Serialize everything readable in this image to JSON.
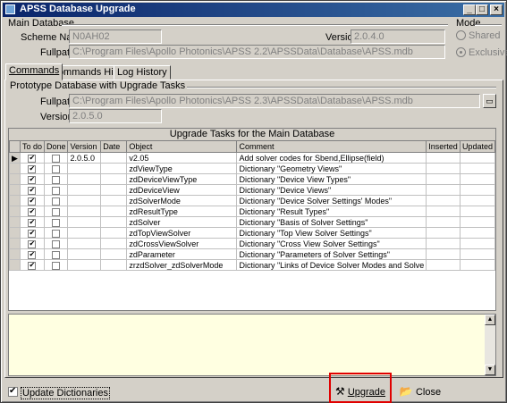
{
  "window": {
    "title": "APSS Database Upgrade"
  },
  "main_database": {
    "group_label": "Main Database",
    "scheme_label": "Scheme Name:",
    "scheme_value": "N0AH02",
    "version_label": "Version:",
    "version_value": "2.0.4.0",
    "fullpath_label": "Fullpath:",
    "fullpath_value": "C:\\Program Files\\Apollo Photonics\\APSS 2.2\\APSSData\\Database\\APSS.mdb"
  },
  "mode": {
    "label": "Mode",
    "options": [
      "Shared",
      "Exclusive"
    ],
    "selected": "Exclusive"
  },
  "tabs": [
    "Commands",
    "Commands History",
    "Log History"
  ],
  "active_tab": "Commands",
  "prototype": {
    "group_label": "Prototype Database with Upgrade Tasks",
    "fullpath_label": "Fullpath:",
    "fullpath_value": "C:\\Program Files\\Apollo Photonics\\APSS 2.3\\APSSData\\Database\\APSS.mdb",
    "version_label": "Version:",
    "version_value": "2.0.5.0"
  },
  "grid": {
    "caption": "Upgrade Tasks for the Main Database",
    "columns": [
      "To do",
      "Done",
      "Version",
      "Date",
      "Object",
      "Comment",
      "Inserted",
      "Updated"
    ],
    "rows": [
      {
        "todo": true,
        "done": false,
        "version": "2.0.5.0",
        "date": "",
        "object": "v2.05",
        "comment": "Add solver codes for Sbend,Ellipse(field)"
      },
      {
        "todo": true,
        "done": false,
        "version": "",
        "date": "",
        "object": "zdViewType",
        "comment": "Dictionary \"Geometry Views\""
      },
      {
        "todo": true,
        "done": false,
        "version": "",
        "date": "",
        "object": "zdDeviceViewType",
        "comment": "Dictionary \"Device View Types\""
      },
      {
        "todo": true,
        "done": false,
        "version": "",
        "date": "",
        "object": "zdDeviceView",
        "comment": "Dictionary \"Device Views\""
      },
      {
        "todo": true,
        "done": false,
        "version": "",
        "date": "",
        "object": "zdSolverMode",
        "comment": "Dictionary \"Device Solver Settings' Modes\""
      },
      {
        "todo": true,
        "done": false,
        "version": "",
        "date": "",
        "object": "zdResultType",
        "comment": "Dictionary \"Result Types\""
      },
      {
        "todo": true,
        "done": false,
        "version": "",
        "date": "",
        "object": "zdSolver",
        "comment": "Dictionary \"Basis of Solver Settings\""
      },
      {
        "todo": true,
        "done": false,
        "version": "",
        "date": "",
        "object": "zdTopViewSolver",
        "comment": "Dictionary \"Top View Solver Settings\""
      },
      {
        "todo": true,
        "done": false,
        "version": "",
        "date": "",
        "object": "zdCrossViewSolver",
        "comment": "Dictionary \"Cross View Solver Settings\""
      },
      {
        "todo": true,
        "done": false,
        "version": "",
        "date": "",
        "object": "zdParameter",
        "comment": "Dictionary \"Parameters of Solver Settings\""
      },
      {
        "todo": true,
        "done": false,
        "version": "",
        "date": "",
        "object": "zrzdSolver_zdSolverMode",
        "comment": "Dictionary \"Links of Device Solver Modes and Solve"
      }
    ]
  },
  "footer": {
    "update_dict_label": "Update Dictionaries",
    "upgrade_label": "Upgrade",
    "close_label": "Close"
  }
}
